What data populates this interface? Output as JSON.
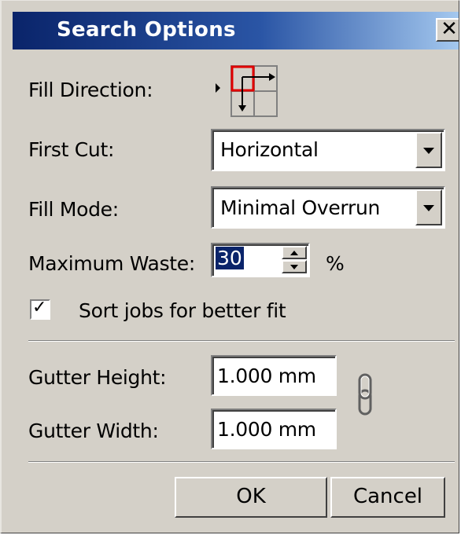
{
  "dialog": {
    "title": "Search Options",
    "close_label": "✕"
  },
  "fill_direction": {
    "label": "Fill Direction:",
    "icon": "fill-direction-grid-icon"
  },
  "first_cut": {
    "label": "First Cut:",
    "value": "Horizontal"
  },
  "fill_mode": {
    "label": "Fill Mode:",
    "value": "Minimal Overrun"
  },
  "maximum_waste": {
    "label": "Maximum Waste:",
    "value": "30",
    "unit": "%"
  },
  "sort_jobs": {
    "label": "Sort jobs for better fit",
    "checked": true,
    "check_mark": "✓"
  },
  "gutter_height": {
    "label": "Gutter Height:",
    "value": "1.000 mm"
  },
  "gutter_width": {
    "label": "Gutter Width:",
    "value": "1.000 mm"
  },
  "link_icon": "chain-link-icon",
  "buttons": {
    "ok": "OK",
    "cancel": "Cancel"
  },
  "colors": {
    "title_bar": "#0a246a",
    "dialog_bg": "#d4d0c8",
    "selection": "#0a246a",
    "icon_accent": "#e00000"
  }
}
